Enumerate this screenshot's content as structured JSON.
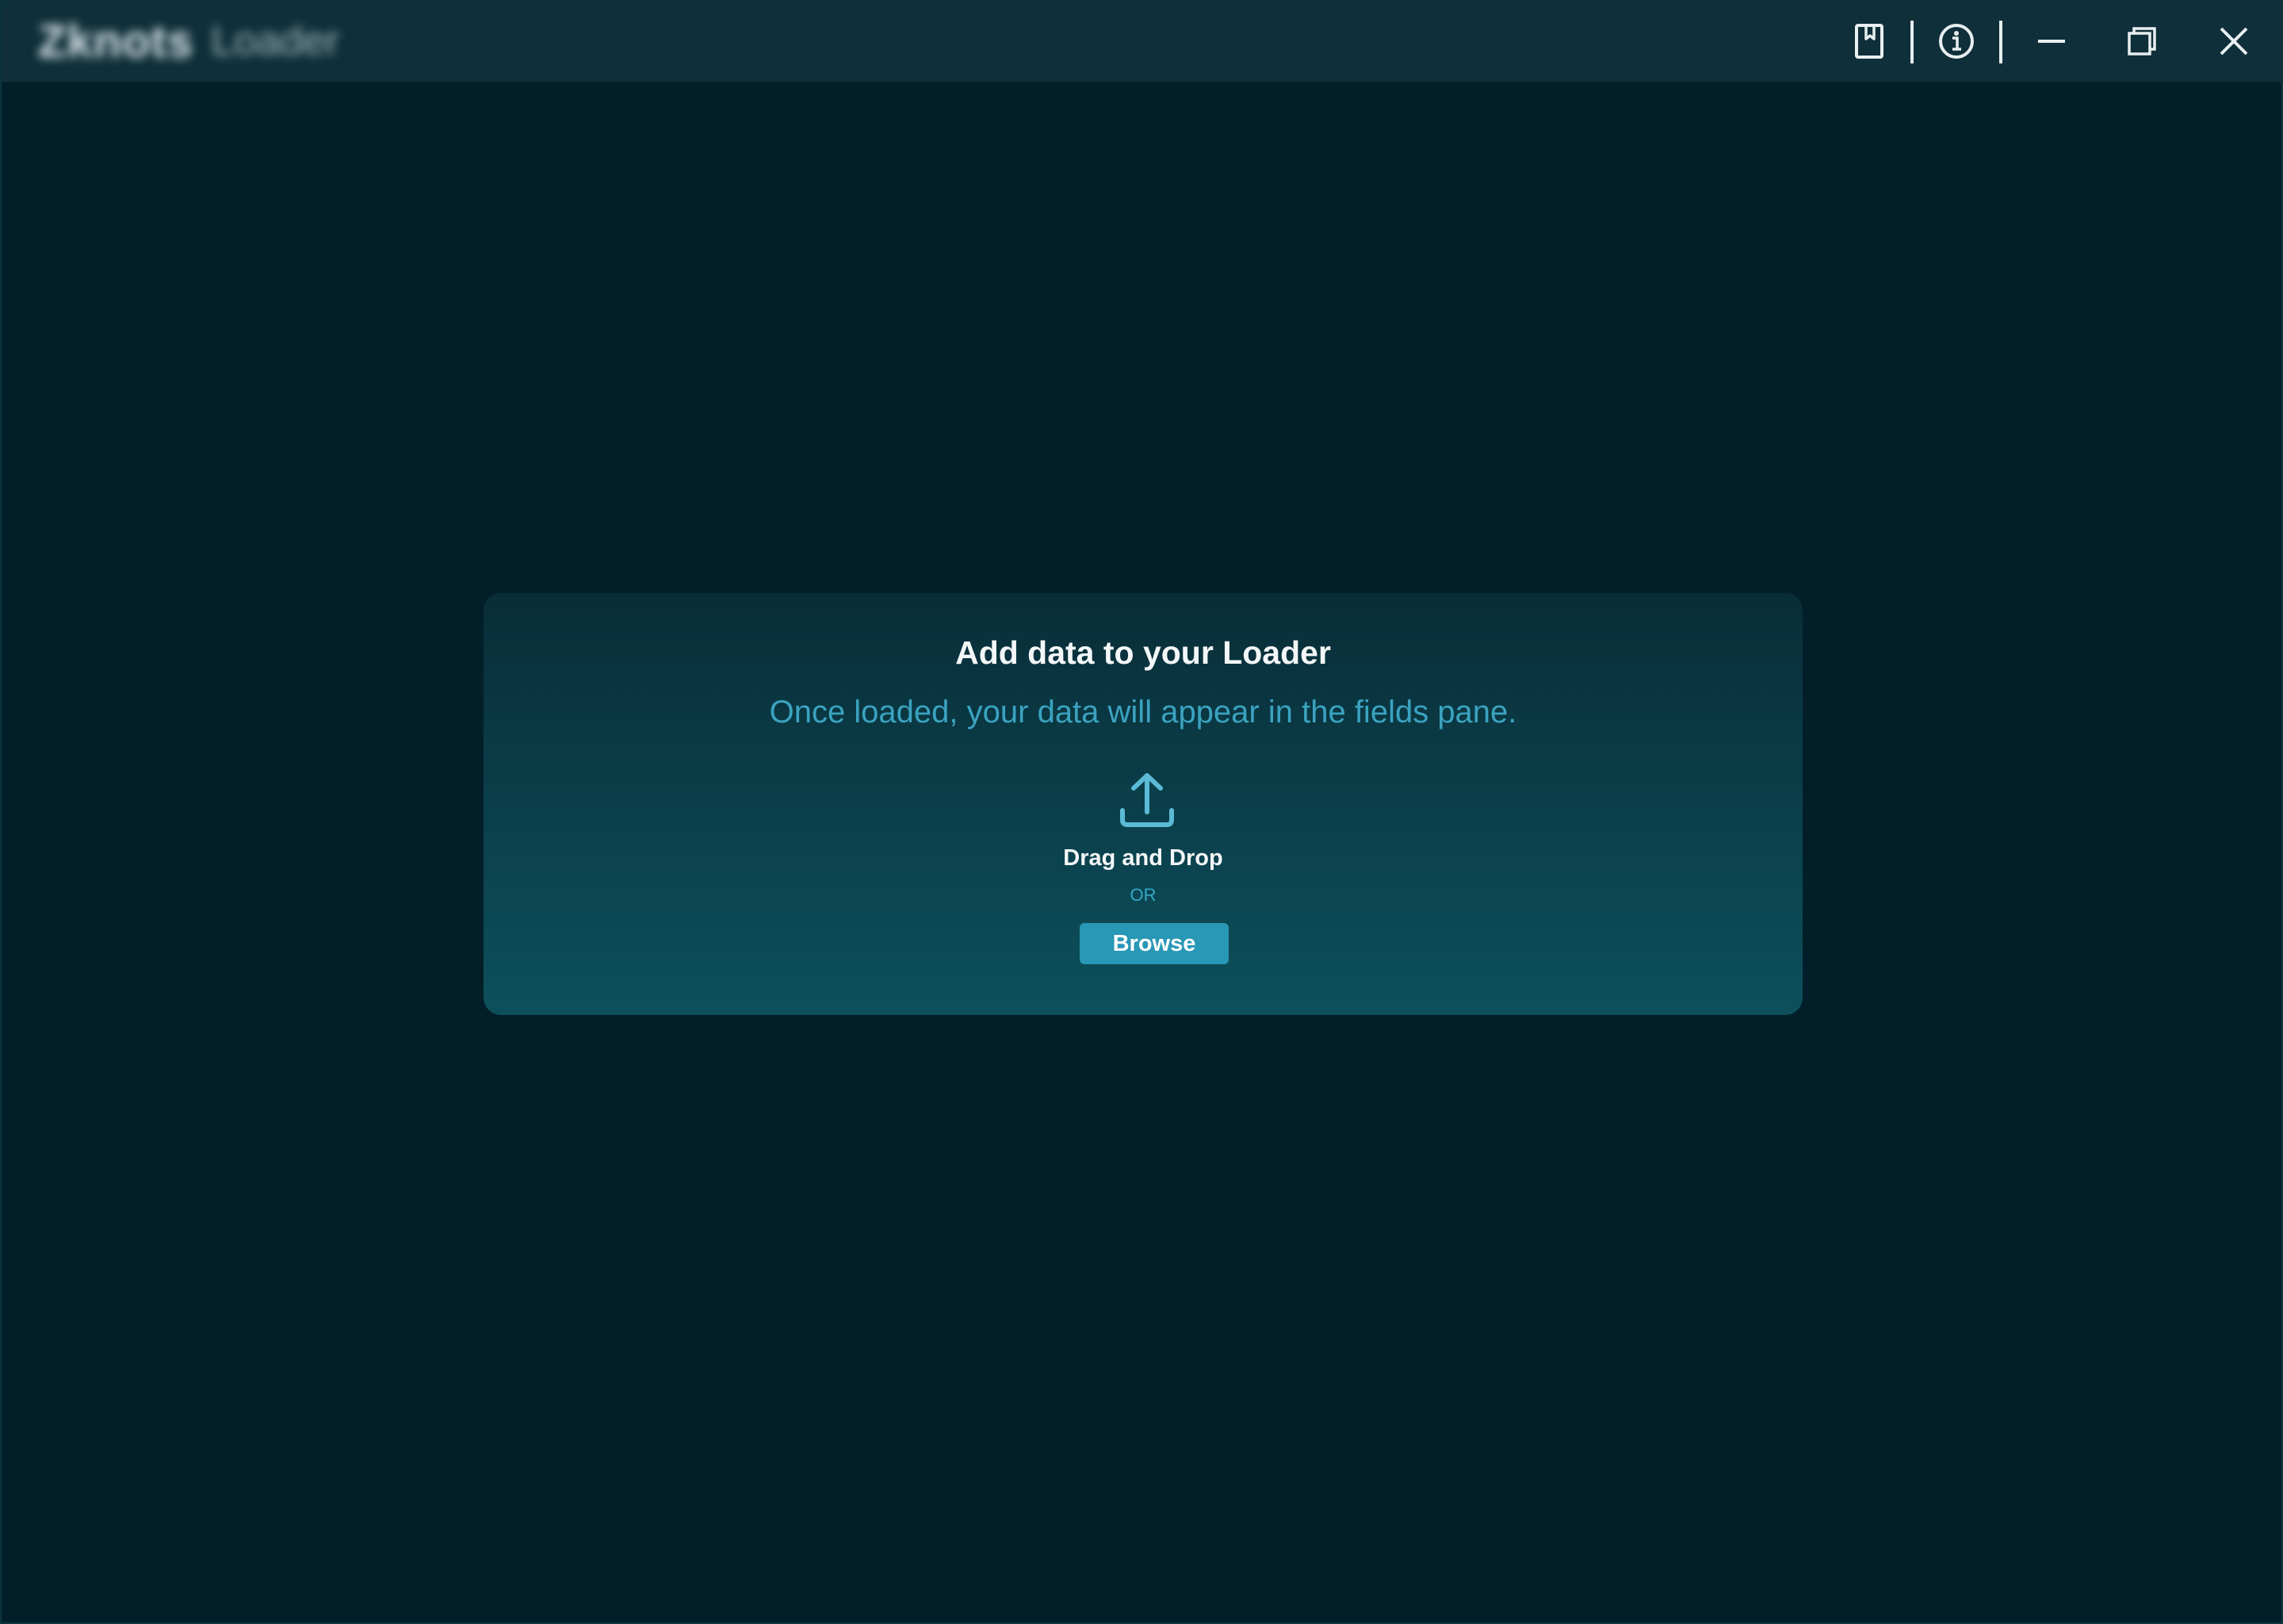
{
  "window": {
    "brand": "Zknots",
    "app_name": "Loader"
  },
  "title_controls": {
    "guide_icon": "book-icon",
    "info_icon": "info-circle-icon",
    "minimize_icon": "minimize-icon",
    "restore_icon": "restore-icon",
    "close_icon": "close-icon"
  },
  "drop_panel": {
    "title": "Add data to your Loader",
    "subtitle": "Once loaded, your data will appear in the fields pane.",
    "icon": "upload-icon",
    "drag_label": "Drag and Drop",
    "or_label": "OR",
    "browse_label": "Browse"
  },
  "colors": {
    "background": "#021f29",
    "titlebar": "#0f2f3a",
    "accent": "#2997b6",
    "subtitle": "#3ba3c0"
  }
}
